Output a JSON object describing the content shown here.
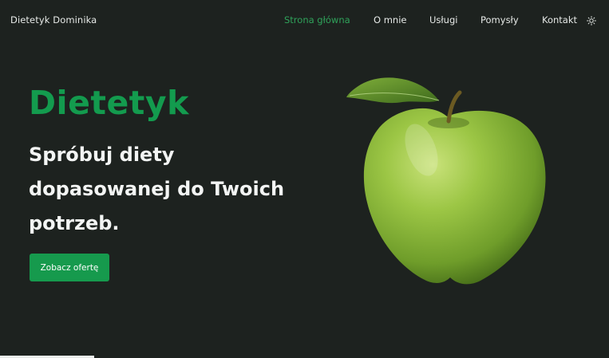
{
  "nav": {
    "brand": "Dietetyk Dominika",
    "items": [
      {
        "label": "Strona główna",
        "active": true
      },
      {
        "label": "O mnie",
        "active": false
      },
      {
        "label": "Usługi",
        "active": false
      },
      {
        "label": "Pomysły",
        "active": false
      },
      {
        "label": "Kontakt",
        "active": false
      }
    ],
    "theme_icon": "sun-icon"
  },
  "hero": {
    "title": "Dietetyk",
    "subtitle_line1": "Spróbuj diety",
    "subtitle_line2": "dopasowanej do Twoich",
    "subtitle_line3": "potrzeb.",
    "cta_label": "Zobacz ofertę",
    "image": "green-apple-image"
  },
  "colors": {
    "background": "#1d221f",
    "accent": "#169a4d",
    "text": "#f3f5f4"
  }
}
